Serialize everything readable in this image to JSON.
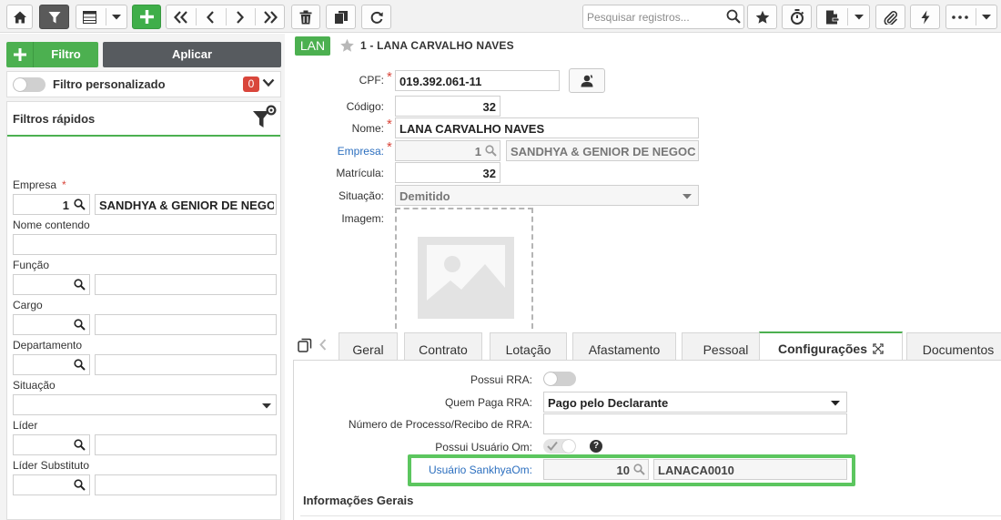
{
  "toolbar": {
    "search_placeholder": "Pesquisar registros...",
    "buttons": [
      "home",
      "filter",
      "grid-view",
      "grid-view-menu",
      "add",
      "first",
      "previous",
      "next",
      "last",
      "delete",
      "duplicate",
      "refresh",
      "favorite",
      "timer",
      "report",
      "report-menu",
      "attach",
      "actions",
      "more",
      "more-menu"
    ]
  },
  "left_panel": {
    "filtro_button": "Filtro",
    "aplicar_button": "Aplicar",
    "filtro_personalizado": "Filtro personalizado",
    "filtro_personalizado_count": "0",
    "filtros_rapidos_title": "Filtros rápidos",
    "fields": {
      "empresa_label": "Empresa",
      "empresa_required": "*",
      "empresa_code": "1",
      "empresa_name": "SANDHYA & GENIOR DE NEGOCIOS",
      "nome_label": "Nome contendo",
      "nome_value": "",
      "funcao_label": "Função",
      "cargo_label": "Cargo",
      "departamento_label": "Departamento",
      "situacao_label": "Situação",
      "lider_label": "Líder",
      "lider_substituto_label": "Líder Substituto"
    }
  },
  "record": {
    "badge": "LAN",
    "title": "1 - LANA CARVALHO NAVES",
    "cpf_label": "CPF:",
    "cpf_value": "019.392.061-11",
    "codigo_label": "Código:",
    "codigo_value": "32",
    "nome_label": "Nome:",
    "nome_value": "LANA CARVALHO NAVES",
    "empresa_label": "Empresa:",
    "empresa_code": "1",
    "empresa_name": "SANDHYA & GENIOR DE NEGOCIOS",
    "matricula_label": "Matrícula:",
    "matricula_value": "32",
    "situacao_label": "Situação:",
    "situacao_value": "Demitido",
    "imagem_label": "Imagem:",
    "required_mark": "*"
  },
  "tabs": {
    "items": [
      "Geral",
      "Contrato",
      "Lotação",
      "Afastamento",
      "Pessoal",
      "Configurações",
      "Documentos"
    ],
    "active": "Configurações"
  },
  "config": {
    "possui_rra_label": "Possui RRA:",
    "possui_rra": false,
    "quem_paga_rra_label": "Quem Paga RRA:",
    "quem_paga_rra_value": "Pago pelo Declarante",
    "numero_processo_label": "Número de Processo/Recibo de RRA:",
    "numero_processo_value": "",
    "possui_usuario_om_label": "Possui Usuário Om:",
    "possui_usuario_om": true,
    "usuario_sankhya_label": "Usuário SankhyaOm:",
    "usuario_sankhya_code": "10",
    "usuario_sankhya_name": "LANACA0010",
    "help_icon": "?",
    "section_title": "Informações Gerais"
  },
  "colors": {
    "accent_green": "#4cb050",
    "highlight_green": "#5cc65f",
    "required_red": "#d9463b",
    "link_blue": "#2c6fbf",
    "dark_button": "#575b5f"
  }
}
